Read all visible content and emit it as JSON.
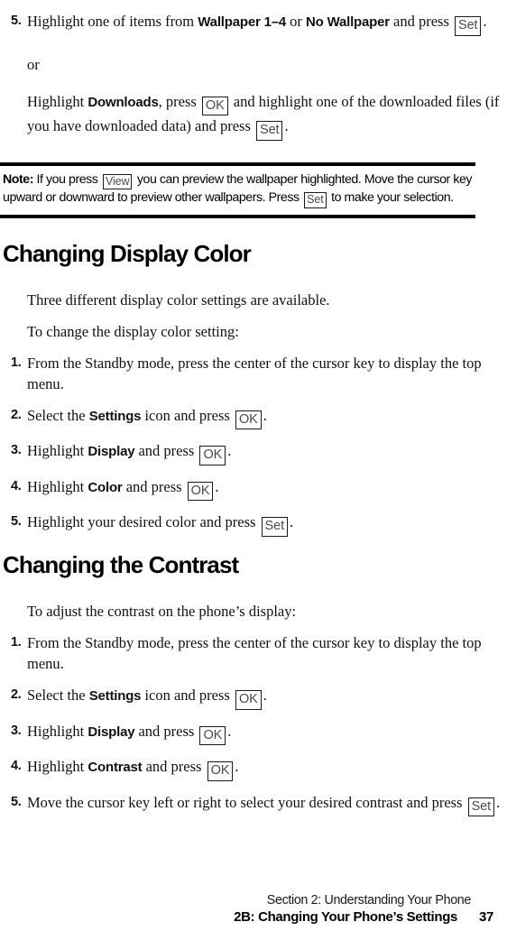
{
  "document": {
    "top_step": {
      "number": "5.",
      "text_before_bold1": "Highlight one of items from ",
      "bold1": "Wallpaper 1–4",
      "text_between": " or ",
      "bold2": "No Wallpaper",
      "text_after": " and press ",
      "key": "Set",
      "period": "."
    },
    "or_text": "or",
    "alt_step": {
      "text_1": "Highlight ",
      "bold1": "Downloads",
      "text_2": ", press ",
      "key1": "OK",
      "text_3": " and highlight one of the downloaded files (if you have downloaded data) and press ",
      "key2": "Set",
      "period": "."
    },
    "note": {
      "label": "Note:",
      "text_1": " If you press ",
      "key1": "View",
      "text_2": " you can preview the wallpaper highlighted. Move the cursor key upward or downward to preview other wallpapers. Press ",
      "key2": "Set",
      "text_3": " to make your selection."
    },
    "sections": [
      {
        "heading": "Changing Display Color",
        "heading_color": "#ED1C24",
        "intro_paragraphs": [
          "Three different display color settings are available.",
          "To change the display color setting:"
        ],
        "steps": [
          {
            "number": "1.",
            "parts": [
              {
                "type": "text",
                "value": "From the Standby mode, press the center of the cursor key to display the top menu."
              }
            ]
          },
          {
            "number": "2.",
            "parts": [
              {
                "type": "text",
                "value": "Select the "
              },
              {
                "type": "bold",
                "value": "Settings"
              },
              {
                "type": "text",
                "value": " icon and press "
              },
              {
                "type": "key",
                "value": "OK"
              },
              {
                "type": "text",
                "value": "."
              }
            ]
          },
          {
            "number": "3.",
            "parts": [
              {
                "type": "text",
                "value": "Highlight "
              },
              {
                "type": "bold",
                "value": "Display"
              },
              {
                "type": "text",
                "value": " and press "
              },
              {
                "type": "key",
                "value": "OK"
              },
              {
                "type": "text",
                "value": "."
              }
            ]
          },
          {
            "number": "4.",
            "parts": [
              {
                "type": "text",
                "value": "Highlight "
              },
              {
                "type": "bold",
                "value": "Color"
              },
              {
                "type": "text",
                "value": " and press "
              },
              {
                "type": "key",
                "value": "OK"
              },
              {
                "type": "text",
                "value": "."
              }
            ]
          },
          {
            "number": "5.",
            "parts": [
              {
                "type": "text",
                "value": "Highlight your desired color and press "
              },
              {
                "type": "key",
                "value": "Set"
              },
              {
                "type": "text",
                "value": "."
              }
            ]
          }
        ]
      },
      {
        "heading": "Changing the Contrast",
        "heading_color": "#ED1C24",
        "intro_paragraphs": [
          "To adjust the contrast on the phone’s display:"
        ],
        "steps": [
          {
            "number": "1.",
            "parts": [
              {
                "type": "text",
                "value": "From the Standby mode, press the center of the cursor key to display the top menu."
              }
            ]
          },
          {
            "number": "2.",
            "parts": [
              {
                "type": "text",
                "value": "Select the "
              },
              {
                "type": "bold",
                "value": "Settings"
              },
              {
                "type": "text",
                "value": " icon and press "
              },
              {
                "type": "key",
                "value": "OK"
              },
              {
                "type": "text",
                "value": "."
              }
            ]
          },
          {
            "number": "3.",
            "parts": [
              {
                "type": "text",
                "value": "Highlight "
              },
              {
                "type": "bold",
                "value": "Display"
              },
              {
                "type": "text",
                "value": " and press "
              },
              {
                "type": "key",
                "value": "OK"
              },
              {
                "type": "text",
                "value": "."
              }
            ]
          },
          {
            "number": "4.",
            "parts": [
              {
                "type": "text",
                "value": "Highlight "
              },
              {
                "type": "bold",
                "value": "Contrast"
              },
              {
                "type": "text",
                "value": " and press "
              },
              {
                "type": "key",
                "value": "OK"
              },
              {
                "type": "text",
                "value": "."
              }
            ]
          },
          {
            "number": "5.",
            "parts": [
              {
                "type": "text",
                "value": "Move the cursor key left or right to select your desired contrast and press "
              },
              {
                "type": "key",
                "value": "Set"
              },
              {
                "type": "text",
                "value": "."
              }
            ]
          }
        ]
      }
    ],
    "footer": {
      "line1": "Section 2: Understanding Your Phone",
      "line2": "2B: Changing Your Phone’s Settings",
      "page_number": "37"
    }
  }
}
